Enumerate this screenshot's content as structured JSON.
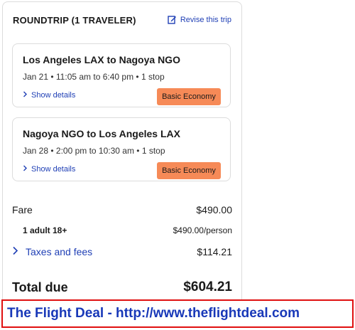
{
  "header": {
    "title": "ROUNDTRIP (1 TRAVELER)",
    "revise_label": "Revise this trip",
    "revise_icon": "edit-icon",
    "link_color": "#1f3fb5"
  },
  "flights": [
    {
      "route": "Los Angeles LAX to Nagoya NGO",
      "details": "Jan 21 • 11:05 am to 6:40 pm • 1 stop",
      "show_details_label": "Show details",
      "fare_class": "Basic Economy"
    },
    {
      "route": "Nagoya NGO to Los Angeles LAX",
      "details": "Jan 28 • 2:00 pm to 10:30 am • 1 stop",
      "show_details_label": "Show details",
      "fare_class": "Basic Economy"
    }
  ],
  "pricing": {
    "fare_label": "Fare",
    "fare_value": "$490.00",
    "adult_label": "1 adult 18+",
    "adult_value": "$490.00/person",
    "taxes_label": "Taxes and fees",
    "taxes_value": "$114.21",
    "total_label": "Total due",
    "total_value": "$604.21"
  },
  "badge_color": "#f68a57",
  "banner": {
    "text": "The Flight Deal - http://www.theflightdeal.com",
    "border_color": "#e01010",
    "text_color": "#1838b8"
  }
}
